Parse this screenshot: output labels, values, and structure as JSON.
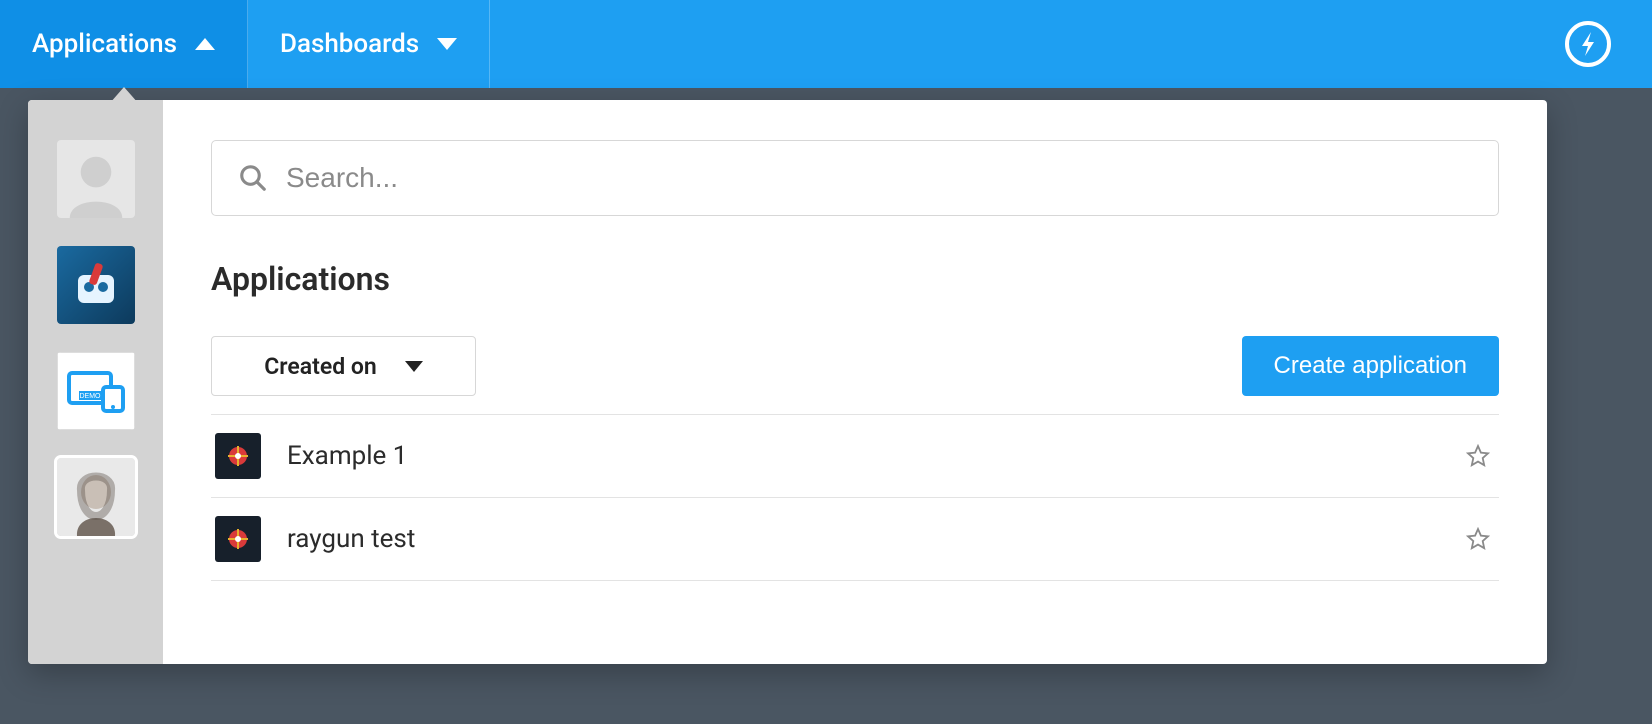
{
  "topbar": {
    "tabs": [
      {
        "label": "Applications",
        "active": true,
        "direction": "up"
      },
      {
        "label": "Dashboards",
        "active": false,
        "direction": "down"
      }
    ]
  },
  "search": {
    "placeholder": "Search..."
  },
  "section": {
    "title": "Applications"
  },
  "sort": {
    "selected": "Created on"
  },
  "actions": {
    "create_label": "Create application"
  },
  "sidebar": {
    "items": [
      {
        "kind": "placeholder",
        "name": "avatar-placeholder"
      },
      {
        "kind": "robot",
        "name": "avatar-robot"
      },
      {
        "kind": "demo",
        "name": "avatar-demo"
      },
      {
        "kind": "person",
        "name": "avatar-person",
        "selected": true
      }
    ]
  },
  "applications": [
    {
      "name": "Example 1"
    },
    {
      "name": "raygun test"
    }
  ]
}
